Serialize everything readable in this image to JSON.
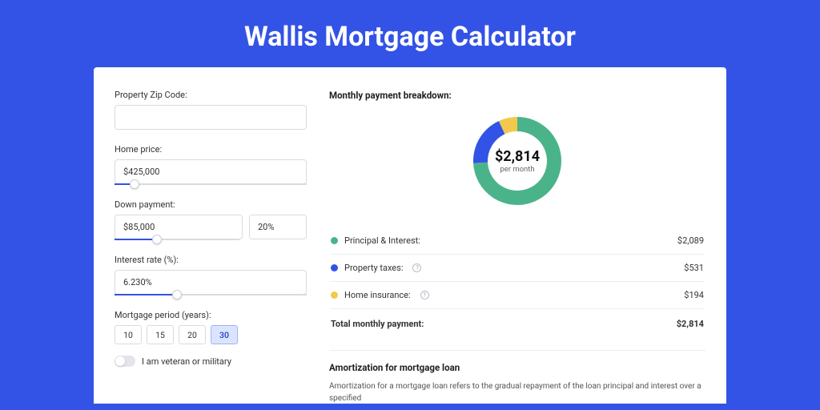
{
  "title": "Wallis Mortgage Calculator",
  "form": {
    "zip_label": "Property Zip Code:",
    "zip_value": "",
    "home_price_label": "Home price:",
    "home_price_value": "$425,000",
    "down_payment_label": "Down payment:",
    "down_payment_value": "$85,000",
    "down_payment_pct": "20%",
    "interest_label": "Interest rate (%):",
    "interest_value": "6.230%",
    "period_label": "Mortgage period (years):",
    "periods": [
      "10",
      "15",
      "20",
      "30"
    ],
    "period_active": "30",
    "veteran_label": "I am veteran or military"
  },
  "breakdown": {
    "title": "Monthly payment breakdown:",
    "center_value": "$2,814",
    "center_sub": "per month",
    "items": [
      {
        "label": "Principal & Interest:",
        "value": "$2,089",
        "color": "#4bb38a"
      },
      {
        "label": "Property taxes:",
        "value": "$531",
        "color": "#3353e6",
        "info": true
      },
      {
        "label": "Home insurance:",
        "value": "$194",
        "color": "#f2c94c",
        "info": true
      }
    ],
    "total_label": "Total monthly payment:",
    "total_value": "$2,814"
  },
  "amort": {
    "title": "Amortization for mortgage loan",
    "body": "Amortization for a mortgage loan refers to the gradual repayment of the loan principal and interest over a specified"
  },
  "chart_data": {
    "type": "pie",
    "title": "Monthly payment breakdown",
    "series": [
      {
        "name": "Principal & Interest",
        "value": 2089,
        "color": "#4bb38a"
      },
      {
        "name": "Property taxes",
        "value": 531,
        "color": "#3353e6"
      },
      {
        "name": "Home insurance",
        "value": 194,
        "color": "#f2c94c"
      }
    ],
    "total": 2814
  }
}
